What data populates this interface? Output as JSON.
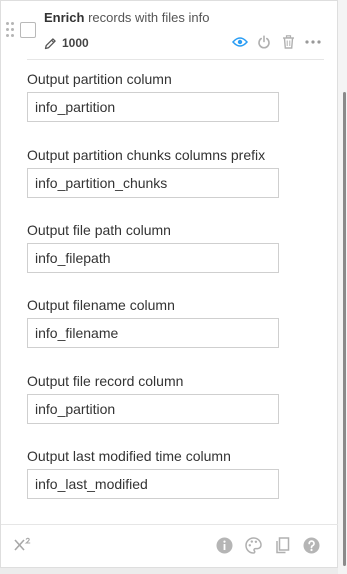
{
  "recipe": {
    "title_bold": "Enrich",
    "title_rest": " records with files info",
    "record_count": "1000"
  },
  "icons": {
    "edit": "pencil-icon",
    "preview": "eye-icon",
    "power": "power-icon",
    "delete": "trash-icon",
    "more": "more-horizontal-icon",
    "formula": "superscript-icon",
    "info": "info-icon",
    "palette": "palette-icon",
    "copy": "copy-icon",
    "help": "help-icon"
  },
  "colors": {
    "accent": "#2a9df4",
    "icon_gray": "#b0b0b0"
  },
  "fields": [
    {
      "label": "Output partition column",
      "value": "info_partition"
    },
    {
      "label": "Output partition chunks columns prefix",
      "value": "info_partition_chunks"
    },
    {
      "label": "Output file path column",
      "value": "info_filepath"
    },
    {
      "label": "Output filename column",
      "value": "info_filename"
    },
    {
      "label": "Output file record column",
      "value": "info_partition"
    },
    {
      "label": "Output last modified time column",
      "value": "info_last_modified"
    }
  ]
}
